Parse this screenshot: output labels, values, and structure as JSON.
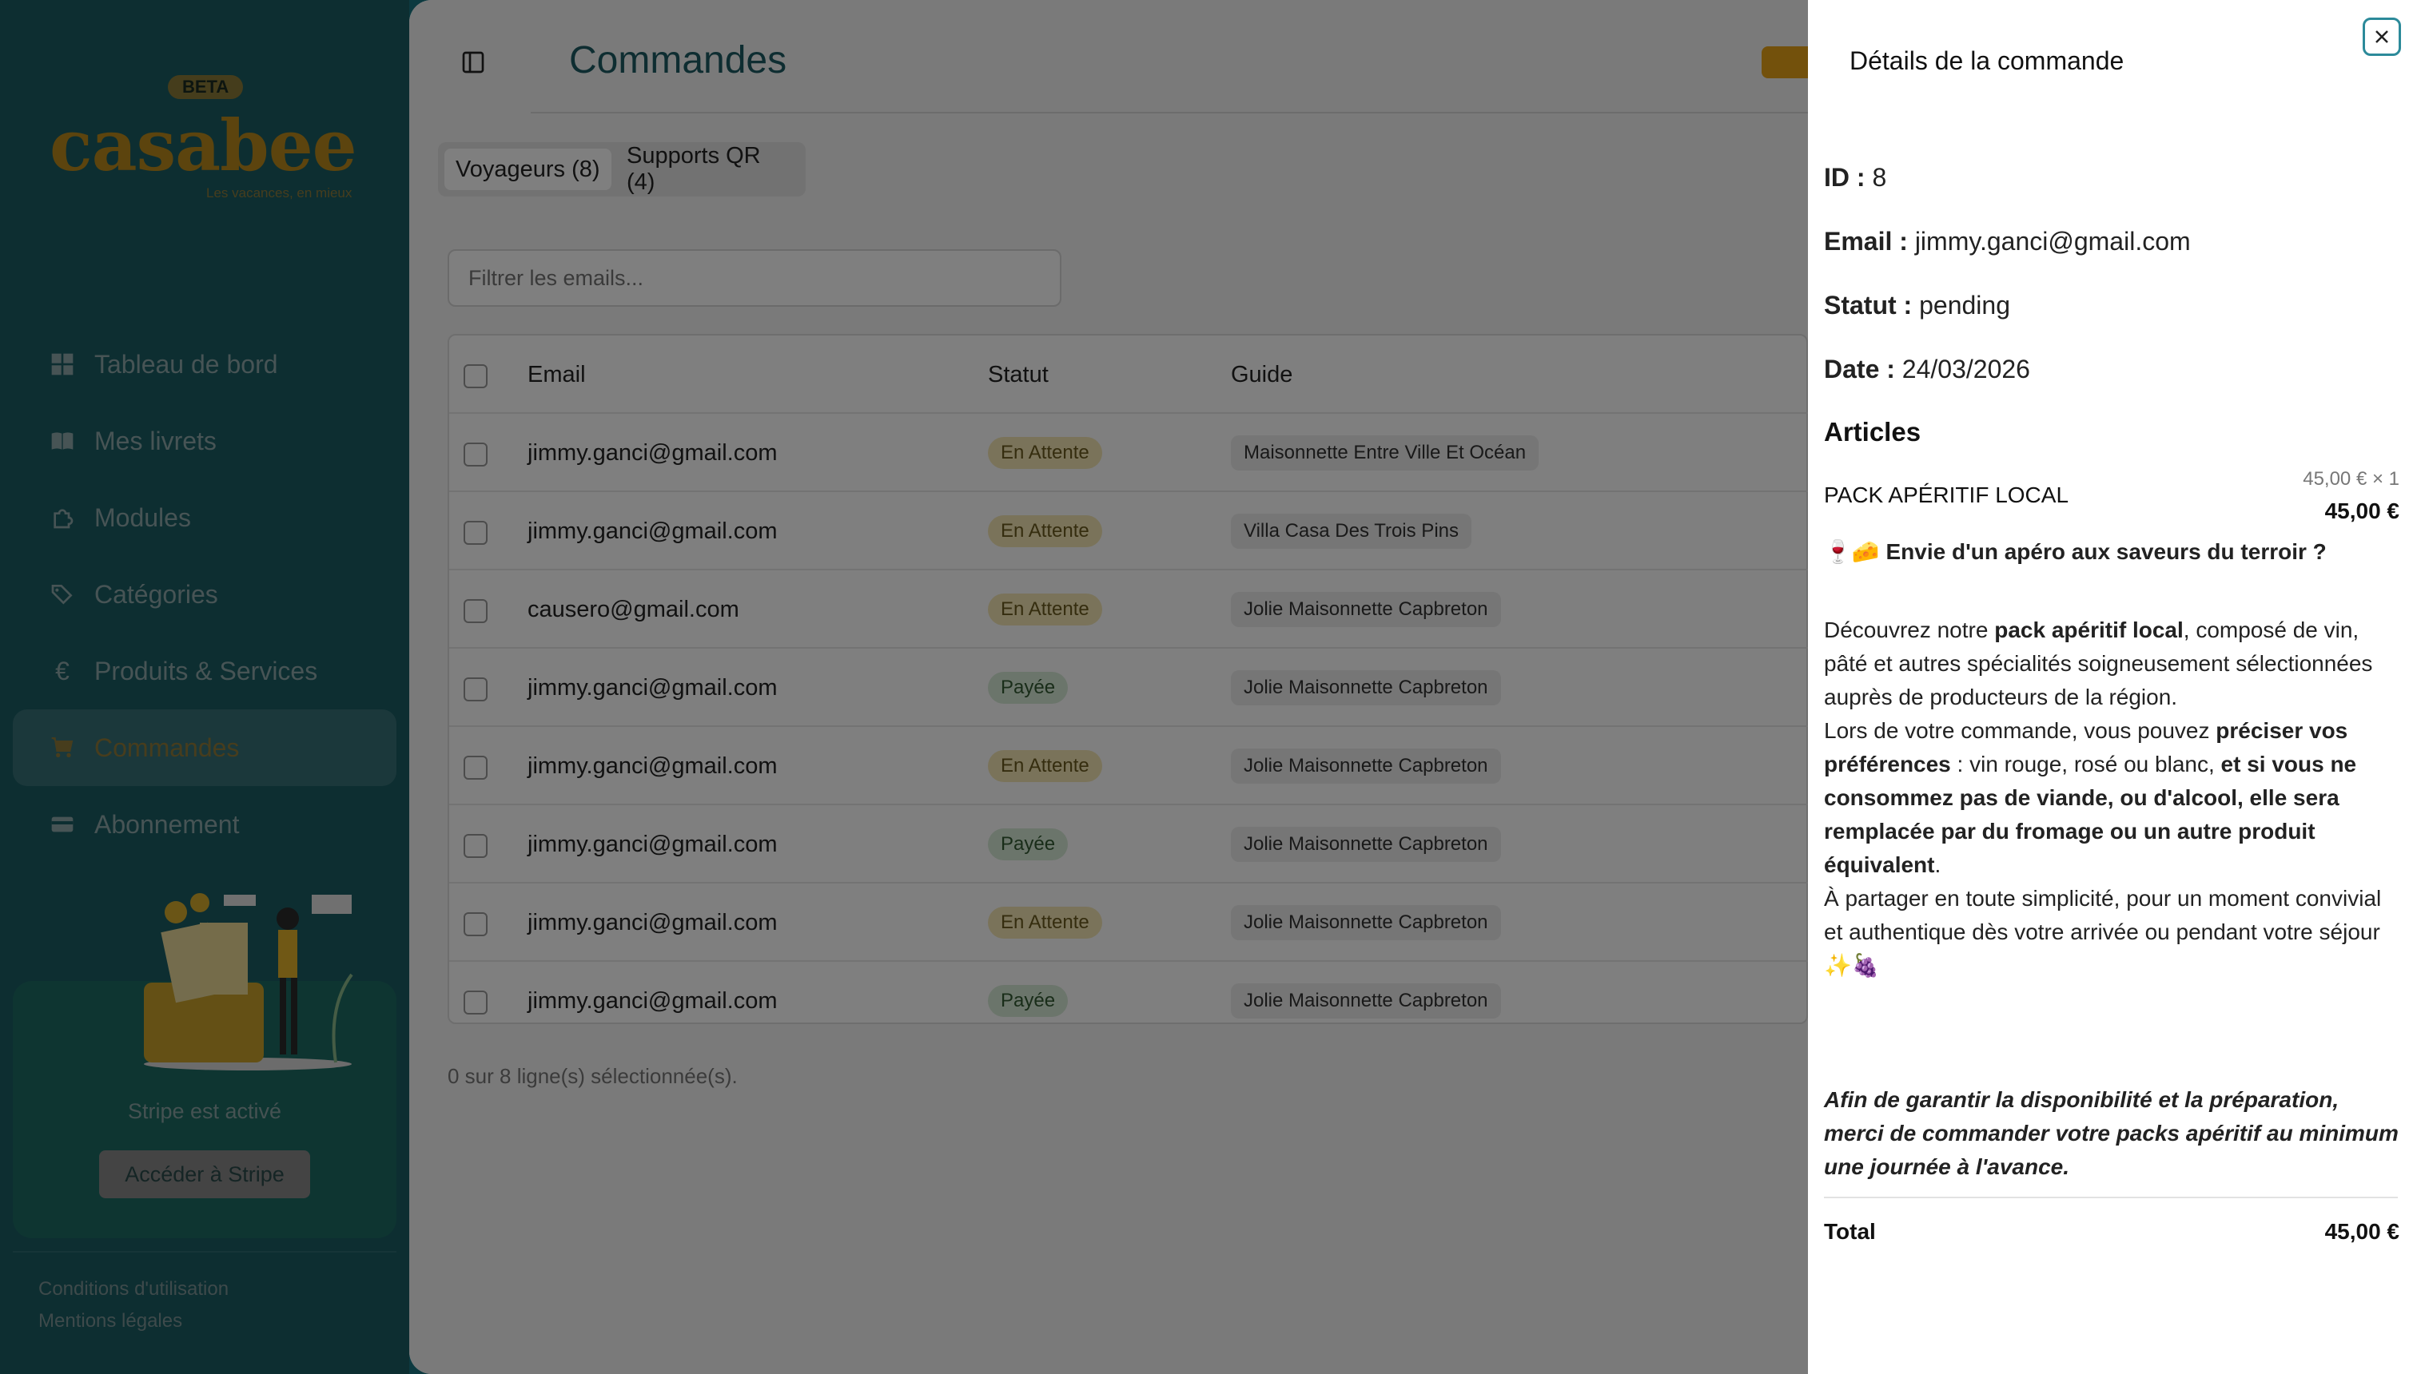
{
  "sidebar": {
    "beta": "BETA",
    "brand": "casabee",
    "tagline": "Les vacances, en mieux",
    "nav": [
      {
        "label": "Tableau de bord",
        "icon": "dashboard-icon"
      },
      {
        "label": "Mes livrets",
        "icon": "book-icon"
      },
      {
        "label": "Modules",
        "icon": "puzzle-icon"
      },
      {
        "label": "Catégories",
        "icon": "tags-icon"
      },
      {
        "label": "Produits & Services",
        "icon": "euro-icon"
      },
      {
        "label": "Commandes",
        "icon": "cart-icon"
      },
      {
        "label": "Abonnement",
        "icon": "card-icon"
      }
    ],
    "active": "Commandes",
    "stripe_text": "Stripe est activé",
    "stripe_button": "Accéder à Stripe",
    "footer": [
      "Conditions d'utilisation",
      "Mentions légales"
    ]
  },
  "main": {
    "title": "Commandes",
    "tabs": [
      {
        "label": "Voyageurs (8)",
        "active": true
      },
      {
        "label": "Supports QR (4)",
        "active": false
      }
    ],
    "filter_placeholder": "Filtrer les emails...",
    "columns": [
      "Email",
      "Statut",
      "Guide"
    ],
    "rows": [
      {
        "email": "jimmy.ganci@gmail.com",
        "status": "En Attente",
        "guide": "Maisonnette Entre Ville Et Océan"
      },
      {
        "email": "jimmy.ganci@gmail.com",
        "status": "En Attente",
        "guide": "Villa Casa Des Trois Pins"
      },
      {
        "email": "causero@gmail.com",
        "status": "En Attente",
        "guide": "Jolie Maisonnette Capbreton"
      },
      {
        "email": "jimmy.ganci@gmail.com",
        "status": "Payée",
        "guide": "Jolie Maisonnette Capbreton"
      },
      {
        "email": "jimmy.ganci@gmail.com",
        "status": "En Attente",
        "guide": "Jolie Maisonnette Capbreton"
      },
      {
        "email": "jimmy.ganci@gmail.com",
        "status": "Payée",
        "guide": "Jolie Maisonnette Capbreton"
      },
      {
        "email": "jimmy.ganci@gmail.com",
        "status": "En Attente",
        "guide": "Jolie Maisonnette Capbreton"
      },
      {
        "email": "jimmy.ganci@gmail.com",
        "status": "Payée",
        "guide": "Jolie Maisonnette Capbreton"
      }
    ],
    "selected_count": "0 sur 8 ligne(s) sélectionnée(s)."
  },
  "details": {
    "title": "Détails de la commande",
    "id_label": "ID :",
    "id": "8",
    "email_label": "Email :",
    "email": "jimmy.ganci@gmail.com",
    "status_label": "Statut :",
    "status": "pending",
    "date_label": "Date :",
    "date": "24/03/2026",
    "articles_label": "Articles",
    "article": {
      "name": "PACK APÉRITIF LOCAL",
      "unit": "45,00 € × 1",
      "price": "45,00 €"
    },
    "desc": {
      "headline": "🍷🧀 Envie d'un apéro aux saveurs du terroir ?",
      "p1a": "Découvrez notre ",
      "p1b": "pack apéritif local",
      "p1c": ", composé de vin, pâté et autres spécialités soigneusement sélectionnées auprès de producteurs de la région.",
      "p2a": "Lors de votre commande, vous pouvez ",
      "p2b": "préciser vos préférences",
      "p2c": " : vin rouge, rosé ou blanc, ",
      "p2d": "et si vous ne consommez pas de viande, ou d'alcool, elle sera remplacée par du fromage ou un autre produit équivalent",
      "p2e": ".",
      "p3": "À partager en toute simplicité, pour un moment convivial et authentique dès votre arrivée  ou pendant votre séjour ✨🍇",
      "note": "Afin de garantir la disponibilité et la préparation, merci de commander votre packs apéritif au minimum une journée à l'avance."
    },
    "total_label": "Total",
    "total": "45,00 €"
  },
  "colors": {
    "sidebar_bg": "#1b5c63",
    "brand_gold": "#b8881c",
    "title_teal": "#1c5a62",
    "pending_badge": "#f4e6b4",
    "paid_badge": "#d6ead6"
  }
}
